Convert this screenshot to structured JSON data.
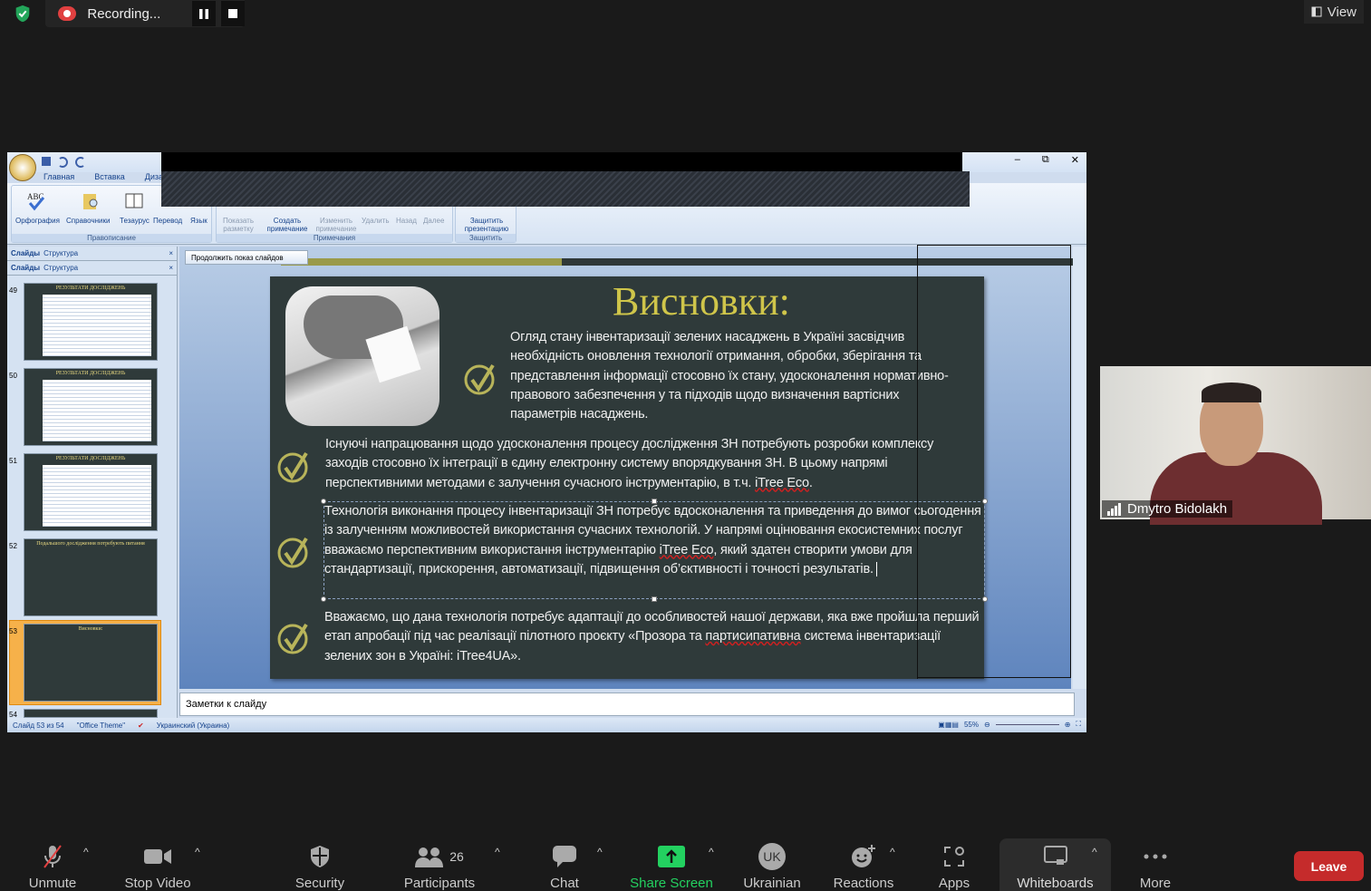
{
  "zoom_meeting": {
    "recording_label": "Recording...",
    "view_label": "View",
    "participant_name": "Dmytro Bidolakh",
    "toolbar": [
      {
        "label": "Unmute",
        "icon": "microphone-muted-icon"
      },
      {
        "label": "Stop Video",
        "icon": "video-camera-icon"
      },
      {
        "label": "Security",
        "icon": "shield-icon"
      },
      {
        "label": "Participants",
        "icon": "participants-icon",
        "count": "26"
      },
      {
        "label": "Chat",
        "icon": "chat-icon"
      },
      {
        "label": "Share Screen",
        "icon": "share-screen-icon"
      },
      {
        "label": "Ukrainian",
        "icon": "language-icon",
        "badge": "UK"
      },
      {
        "label": "Reactions",
        "icon": "reactions-icon"
      },
      {
        "label": "Apps",
        "icon": "apps-icon"
      },
      {
        "label": "Whiteboards",
        "icon": "whiteboard-icon"
      },
      {
        "label": "More",
        "icon": "more-icon"
      }
    ],
    "leave_label": "Leave",
    "colors": {
      "share_green": "#23d160",
      "leave_red": "#c52b2b",
      "bg": "#1a1a1a"
    }
  },
  "powerpoint": {
    "tabs": [
      "Главная",
      "Вставка",
      "Диза"
    ],
    "ribbon": {
      "proofing": {
        "buttons": [
          "Орфография",
          "Справочники",
          "Тезаурус",
          "Перевод",
          "Язык"
        ],
        "group": "Правописание"
      },
      "show_markup": "Показать разметку",
      "comments": {
        "buttons": [
          "Создать примечание",
          "Изменить примечание",
          "Удалить",
          "Назад",
          "Далее"
        ],
        "group": "Примечания"
      },
      "protect": {
        "button": "Защитить презентацию",
        "group": "Защитить"
      }
    },
    "pane_tabs": [
      "Слайды",
      "Структура"
    ],
    "thumbnails": [
      {
        "num": "49",
        "title": "РЕЗУЛЬТАТИ ДОСЛІДЖЕНЬ"
      },
      {
        "num": "50",
        "title": "РЕЗУЛЬТАТИ ДОСЛІДЖЕНЬ"
      },
      {
        "num": "51",
        "title": "РЕЗУЛЬТАТИ ДОСЛІДЖЕНЬ"
      },
      {
        "num": "52",
        "title": "Подальшого дослідження потребують питання"
      },
      {
        "num": "53",
        "title": "Висновки:"
      },
      {
        "num": "54",
        "title": ""
      }
    ],
    "continue_show": "Продолжить показ слайдов",
    "slide": {
      "title": "Висновки:",
      "p1": "Огляд стану інвентаризації зелених насаджень в Україні засвідчив необхідність оновлення технології отримання, обробки, зберігання та представлення інформації стосовно їх стану, удосконалення нормативно-правового забезпечення у  та підходів щодо визначення вартісних параметрів насаджень.",
      "p2a": "Існуючі напрацювання щодо удосконалення процесу дослідження ЗН потребують розробки комплексу заходів стосовно їх інтеграції в єдину електронну систему впорядкування ЗН. В цьому напрямі перспективними методами є залучення сучасного інструментарію, в т.ч. ",
      "p2b": "iTree Eco",
      "p2c": ".",
      "p3a": "Технологія виконання процесу інвентаризації ЗН потребує вдосконалення та приведення до вимог сьогодення із залученням можливостей використання сучасних технологій. У напрямі оцінювання екосистемних послуг вважаємо перспективним використання інструментарію ",
      "p3b": "iTree Eco",
      "p3c": ", який здатен створити умови для стандартизації, прискорення, автоматизації, підвищення об’єктивності і точності результатів.",
      "p4a": "Вважаємо, що дана технологія потребує адаптації до особливостей нашої держави, яка вже пройшла перший етап апробації під час реалізації пілотного проєкту «Прозора та ",
      "p4b": "партисипативна",
      "p4c": " система інвентаризації зелених зон в Україні: iTree4UA».",
      "colors": {
        "background": "#2f3a3a",
        "title": "#cfc54a",
        "check": "#b8b45a"
      }
    },
    "notes_placeholder": "Заметки к слайду",
    "status": {
      "slide": "Слайд 53 из 54",
      "theme": "\"Office Theme\"",
      "language": "Украинский (Украина)",
      "zoom": "55%"
    }
  }
}
